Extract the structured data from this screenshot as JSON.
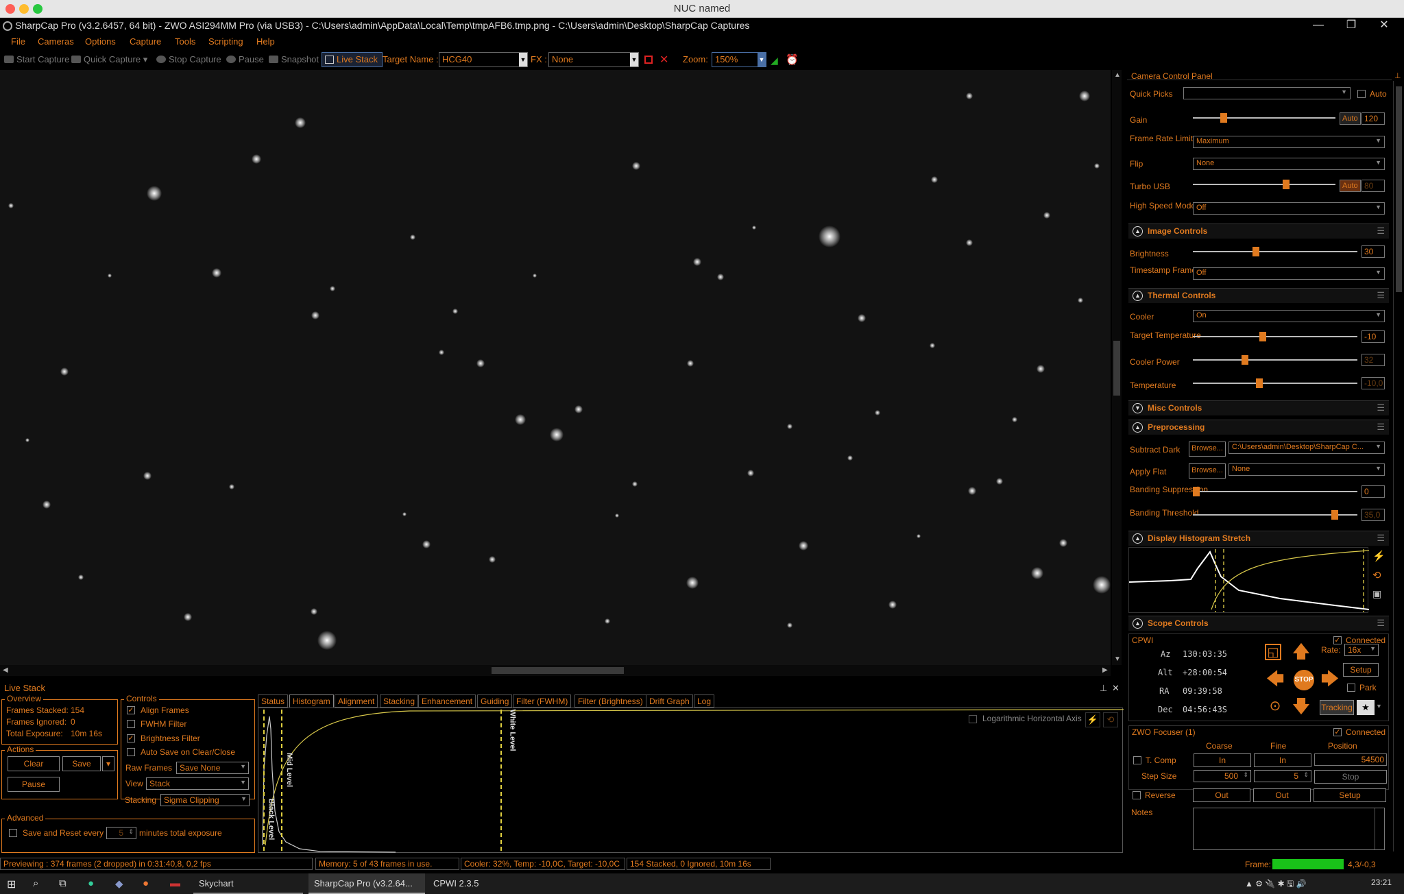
{
  "window": {
    "title": "NUC named",
    "app_title": "SharpCap Pro (v3.2.6457, 64 bit) - ZWO ASI294MM Pro (via USB3) - C:\\Users\\admin\\AppData\\Local\\Temp\\tmpAFB6.tmp.png - C:\\Users\\admin\\Desktop\\SharpCap Captures",
    "controls": {
      "minimize": "—",
      "restore": "❐",
      "close": "✕"
    }
  },
  "menu": [
    "File",
    "Cameras",
    "Options",
    "Capture",
    "Tools",
    "Scripting",
    "Help"
  ],
  "toolbar": {
    "start_capture": "Start Capture",
    "quick_capture": "Quick Capture",
    "stop_capture": "Stop Capture",
    "pause": "Pause",
    "snapshot": "Snapshot",
    "live_stack": "Live Stack",
    "target_name_label": "Target Name :",
    "target_name_value": "HCG40",
    "fx_label": "FX :",
    "fx_value": "None",
    "zoom_label": "Zoom:",
    "zoom_value": "150%"
  },
  "live_stack": {
    "title": "Live Stack",
    "overview": {
      "title": "Overview",
      "frames_stacked_label": "Frames Stacked:",
      "frames_stacked": "154",
      "frames_ignored_label": "Frames Ignored:",
      "frames_ignored": "0",
      "total_exposure_label": "Total Exposure:",
      "total_exposure": "10m 16s"
    },
    "actions": {
      "title": "Actions",
      "clear": "Clear",
      "save": "Save",
      "pause": "Pause"
    },
    "controls": {
      "title": "Controls",
      "align_frames": "Align Frames",
      "fwhm_filter": "FWHM Filter",
      "brightness_filter": "Brightness Filter",
      "auto_save": "Auto Save on Clear/Close",
      "raw_frames_label": "Raw Frames",
      "raw_frames_value": "Save None",
      "view_label": "View",
      "view_value": "Stack",
      "stacking_label": "Stacking",
      "stacking_value": "Sigma Clipping"
    },
    "advanced": {
      "title": "Advanced",
      "save_reset_label": "Save and Reset every",
      "save_reset_value": "5",
      "minutes_label": "minutes total exposure"
    },
    "tabs": [
      "Status",
      "Histogram",
      "Alignment",
      "Stacking",
      "Enhancement",
      "Guiding",
      "Filter (FWHM)",
      "Filter (Brightness)",
      "Drift Graph",
      "Log"
    ],
    "active_tab": "Histogram",
    "histogram": {
      "log_axis_label": "Logarithmic Horizontal Axis",
      "black_level": "Black Level",
      "mid_level": "Mid Level",
      "white_level": "White Level"
    }
  },
  "status_bar": {
    "preview": "Previewing : 374 frames (2 dropped) in 0:31:40,8, 0,2 fps",
    "memory": "Memory: 5 of 43 frames in use.",
    "cooler": "Cooler: 32%, Temp: -10,0C, Target: -10,0C",
    "stacked": "154 Stacked, 0 Ignored, 10m 16s",
    "frame_label": "Frame:",
    "frame_value": "4,3/-0,3"
  },
  "camera_panel": {
    "title": "Camera Control Panel",
    "quick_picks": "Quick Picks",
    "auto": "Auto",
    "gain_label": "Gain",
    "gain_value": "120",
    "gain_level": 0.2,
    "frame_rate_label": "Frame Rate Limit",
    "frame_rate_value": "Maximum",
    "flip_label": "Flip",
    "flip_value": "None",
    "turbo_label": "Turbo USB",
    "turbo_value": "80",
    "turbo_level": 0.66,
    "high_speed_label": "High Speed Mode",
    "high_speed_value": "Off",
    "image_controls": "Image Controls",
    "brightness_label": "Brightness",
    "brightness_value": "30",
    "brightness_level": 0.38,
    "timestamp_label": "Timestamp Frames",
    "timestamp_value": "Off",
    "thermal_controls": "Thermal Controls",
    "cooler_label": "Cooler",
    "cooler_value": "On",
    "target_temp_label": "Target Temperature",
    "target_temp_value": "-10",
    "target_temp_level": 0.42,
    "cooler_power_label": "Cooler Power",
    "cooler_power_value": "32",
    "cooler_power_level": 0.31,
    "temperature_label": "Temperature",
    "temperature_value": "-10,0",
    "temperature_level": 0.4,
    "misc_controls": "Misc Controls",
    "preprocessing": "Preprocessing",
    "subtract_dark_label": "Subtract Dark",
    "subtract_dark_value": "C:\\Users\\admin\\Desktop\\SharpCap C...",
    "browse": "Browse...",
    "apply_flat_label": "Apply Flat",
    "apply_flat_value": "None",
    "banding_supp_label": "Banding Suppression",
    "banding_supp_value": "0",
    "banding_supp_level": 0.0,
    "banding_thresh_label": "Banding Threshold",
    "banding_thresh_value": "35,0",
    "banding_thresh_level": 0.88,
    "histogram_stretch": "Display Histogram Stretch",
    "scope_controls": "Scope Controls",
    "scope_name": "CPWI",
    "connected": "Connected",
    "az_label": "Az",
    "az_value": "130:03:35",
    "alt_label": "Alt",
    "alt_value": "+28:00:54",
    "ra_label": "RA",
    "ra_value": "09:39:58",
    "dec_label": "Dec",
    "dec_value": "04:56:43S",
    "rate_label": "Rate:",
    "rate_value": "16x",
    "stop": "STOP",
    "setup": "Setup",
    "park": "Park",
    "tracking": "Tracking",
    "focuser_name": "ZWO Focuser (1)",
    "coarse": "Coarse",
    "fine": "Fine",
    "position": "Position",
    "t_comp": "T. Comp",
    "in": "In",
    "out": "Out",
    "position_value": "54500",
    "step_size_label": "Step Size",
    "coarse_step": "500",
    "fine_step": "5",
    "stop_btn": "Stop",
    "reverse": "Reverse",
    "notes": "Notes"
  },
  "taskbar": {
    "skychart": "Skychart",
    "sharpcap": "SharpCap Pro (v3.2.64...",
    "cpwi": "CPWI 2.3.5",
    "time": "23:21"
  },
  "colors": {
    "accent": "#e07a1f",
    "background": "#000000",
    "frame_bar": "#19c219"
  }
}
